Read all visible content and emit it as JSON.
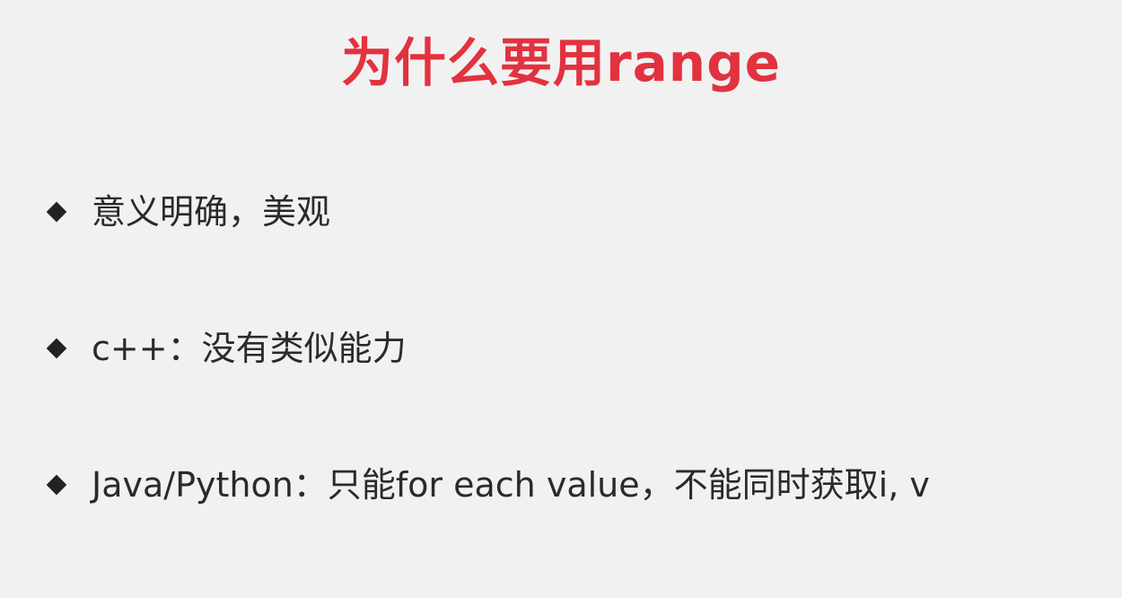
{
  "slide": {
    "title": "为什么要用range",
    "bullets": [
      {
        "text": "意义明确，美观"
      },
      {
        "text": "c++：没有类似能力"
      },
      {
        "text": "Java/Python：只能for each value，不能同时获取i, v"
      }
    ]
  },
  "colors": {
    "title": "#e2323f",
    "text": "#2a2a2a",
    "background": "#f1f1f1"
  },
  "icons": {
    "bullet": "diamond-bullet-icon"
  }
}
